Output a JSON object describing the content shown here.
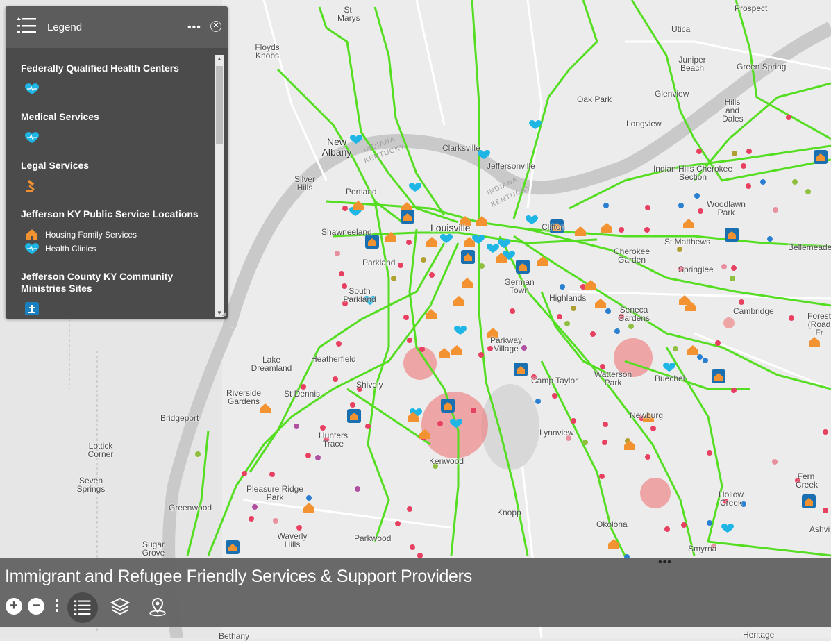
{
  "legend": {
    "title": "Legend",
    "more": "•••",
    "close": "✕",
    "sections": [
      {
        "title": "Federally Qualified Health Centers"
      },
      {
        "title": "Medical Services"
      },
      {
        "title": "Legal Services"
      },
      {
        "title": "Jefferson KY Public Service Locations",
        "items": [
          "Housing Family Services",
          "Health Clinics"
        ]
      },
      {
        "title": "Jefferson County KY Community Ministries Sites"
      }
    ]
  },
  "app": {
    "title": "Immigrant and Refugee Friendly Services & Support Providers",
    "more": "•••"
  },
  "toolbar": {
    "zoom_in": "+",
    "zoom_out": "−"
  },
  "map": {
    "states": [
      "INDIANA",
      "KENTUCKY",
      "INDIANA",
      "KENTUCKY"
    ],
    "places": {
      "st_marys": "St Marys",
      "floyds_knobs": "Floyds Knobs",
      "utica": "Utica",
      "prospect": "Prospect",
      "juniper_beach": "Juniper Beach",
      "green_spring": "Green Spring",
      "oak_park": "Oak Park",
      "glenview": "Glenview",
      "hills_and_dales": "Hills and Dales",
      "longview": "Longview",
      "new_albany": "New Albany",
      "clarksville": "Clarksville",
      "jeffersonville": "Jeffersonville",
      "indian_hills": "Indian Hills Cherokee Section",
      "silver_hills": "Silver Hills",
      "portland": "Portland",
      "woodlawn_park": "Woodlawn Park",
      "clifton": "Clifton",
      "shawnee": "Shawneeland",
      "louisville": "Louisville",
      "cherokee_garden": "Cherokee Garden",
      "st_matthews": "St Matthews",
      "bellemeade": "Bellemeade",
      "parkland": "Parkland",
      "springlee": "Springlee",
      "german_town": "German Town",
      "south_parkland": "South Parkland",
      "highlands": "Highlands",
      "seneca_gardens": "Seneca Gardens",
      "cambridge": "Cambridge",
      "forest": "Forest (Road Fr",
      "heatherfield": "Heatherfield",
      "parkway_village": "Parkway Village",
      "lake_dreamland": "Lake Dreamland",
      "shively": "Shively",
      "camp_taylor": "Camp Taylor",
      "watterson_park": "Watterson Park",
      "buechel": "Buechel",
      "riverside_gardens": "Riverside Gardens",
      "st_dennis": "St Dennis",
      "bridgeport": "Bridgeport",
      "newburg": "Newburg",
      "hunters_trace": "Hunters Trace",
      "lynnview": "Lynnview",
      "lottick_corner": "Lottick Corner",
      "kenwood": "Kenwood",
      "fern_creek": "Fern Creek",
      "seven_springs": "Seven Springs",
      "pleasure_ridge": "Pleasure Ridge Park",
      "hollow_creek": "Hollow Creek",
      "greenwood": "Greenwood",
      "knopp": "Knopp",
      "okolona": "Okolona",
      "ashville": "Ashvi",
      "waverly_hills": "Waverly Hills",
      "sugar_grove": "Sugar Grove",
      "parkwood": "Parkwood",
      "smyrna": "Smyrna",
      "bethany": "Bethany",
      "heritage": "Heritage"
    }
  },
  "colors": {
    "route": "#55dd22",
    "health": "#1fb6e6",
    "housing": "#f39231",
    "site": "#1a7fbf",
    "buffer": "#f08080",
    "panel": "#4b4b4b",
    "bar": "#646464"
  }
}
